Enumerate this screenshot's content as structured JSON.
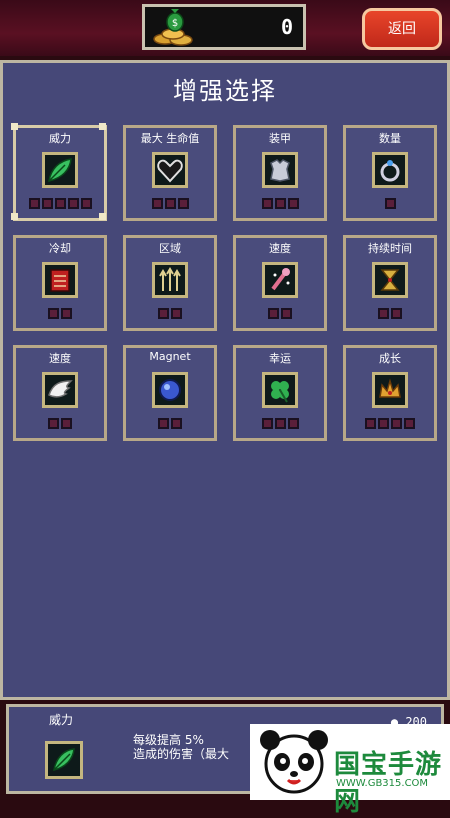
{
  "header": {
    "coin_count": "0",
    "back_label": "返回"
  },
  "panel": {
    "title": "增强选择"
  },
  "cards": [
    {
      "label": "威力",
      "icon": "leaf-icon",
      "level": 0,
      "max": 5
    },
    {
      "label": "最大 生命值",
      "icon": "heart-icon",
      "level": 0,
      "max": 3
    },
    {
      "label": "装甲",
      "icon": "armor-icon",
      "level": 0,
      "max": 3
    },
    {
      "label": "数量",
      "icon": "ring-icon",
      "level": 0,
      "max": 1
    },
    {
      "label": "冷却",
      "icon": "book-icon",
      "level": 0,
      "max": 2
    },
    {
      "label": "区域",
      "icon": "arrows-icon",
      "level": 0,
      "max": 2
    },
    {
      "label": "速度",
      "icon": "wand-icon",
      "level": 0,
      "max": 2
    },
    {
      "label": "持续时间",
      "icon": "hourglass-icon",
      "level": 0,
      "max": 2
    },
    {
      "label": "速度",
      "icon": "wings-icon",
      "level": 0,
      "max": 2
    },
    {
      "label": "Magnet",
      "icon": "orb-icon",
      "level": 0,
      "max": 2
    },
    {
      "label": "幸运",
      "icon": "clover-icon",
      "level": 0,
      "max": 3
    },
    {
      "label": "成长",
      "icon": "crown-icon",
      "level": 0,
      "max": 4
    }
  ],
  "info": {
    "name": "威力",
    "desc_line1": "每级提高 5%",
    "desc_line2": "造成的伤害（最大",
    "cost": "200"
  },
  "watermark": {
    "brand": "国宝手游网",
    "url": "WWW.GB315.COM"
  },
  "colors": {
    "panel_bg": "#464878",
    "card_border": "#b8a888",
    "pip_color": "#5a1f3a",
    "back_button": "#d83420",
    "top_bar": "#5a1022"
  }
}
